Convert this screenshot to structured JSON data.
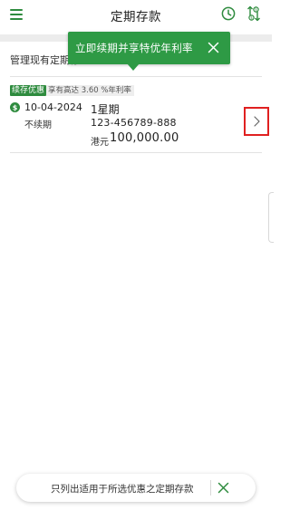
{
  "header": {
    "title": "定期存款",
    "menu_icon": "hamburger-menu-icon",
    "clock_icon": "clock-icon",
    "swap_icon": "currency-exchange-icon"
  },
  "tooltip": {
    "text": "立即续期并享特优年利率",
    "close_icon": "close-icon"
  },
  "section": {
    "title": "管理现有定期存"
  },
  "deposit": {
    "badge": "续存优惠",
    "rate_tag": "享有高达 3.60 %年利率",
    "status_icon": "dollar-circle-icon",
    "maturity_date": "10-04-2024",
    "renew_status": "不续期",
    "term": "1星期",
    "account": "123-456789-888",
    "currency": "港元",
    "amount": "100,000.00",
    "chevron_icon": "chevron-right-icon"
  },
  "filter": {
    "text": "只列出适用于所选优惠之定期存款",
    "close_icon": "close-icon"
  },
  "colors": {
    "brand_green": "#2e8b3e",
    "tooltip_green": "#2e9a45",
    "highlight_red": "#e02020"
  }
}
